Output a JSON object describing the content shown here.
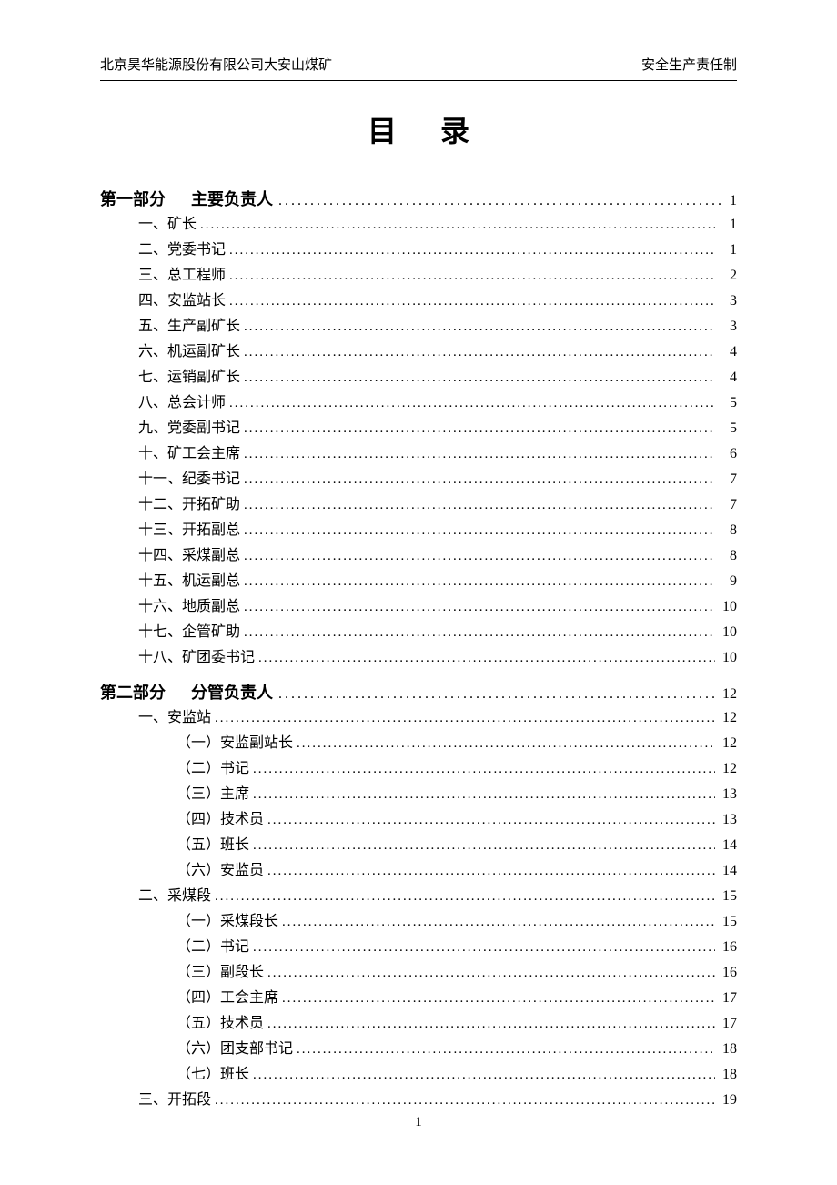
{
  "header": {
    "left": "北京昊华能源股份有限公司大安山煤矿",
    "right": "安全生产责任制"
  },
  "title": "目录",
  "footer_page": "1",
  "sections": [
    {
      "label": "第一部分",
      "title": "主要负责人",
      "page": "1",
      "items": [
        {
          "level": 1,
          "text": "一、矿长",
          "page": "1"
        },
        {
          "level": 1,
          "text": "二、党委书记",
          "page": "1"
        },
        {
          "level": 1,
          "text": "三、总工程师",
          "page": "2"
        },
        {
          "level": 1,
          "text": "四、安监站长",
          "page": "3"
        },
        {
          "level": 1,
          "text": "五、生产副矿长",
          "page": "3"
        },
        {
          "level": 1,
          "text": "六、机运副矿长",
          "page": "4"
        },
        {
          "level": 1,
          "text": "七、运销副矿长",
          "page": "4"
        },
        {
          "level": 1,
          "text": "八、总会计师",
          "page": "5"
        },
        {
          "level": 1,
          "text": "九、党委副书记",
          "page": "5"
        },
        {
          "level": 1,
          "text": "十、矿工会主席",
          "page": "6"
        },
        {
          "level": 1,
          "text": "十一、纪委书记",
          "page": "7"
        },
        {
          "level": 1,
          "text": "十二、开拓矿助",
          "page": "7"
        },
        {
          "level": 1,
          "text": "十三、开拓副总",
          "page": "8"
        },
        {
          "level": 1,
          "text": "十四、采煤副总",
          "page": "8"
        },
        {
          "level": 1,
          "text": "十五、机运副总",
          "page": "9"
        },
        {
          "level": 1,
          "text": "十六、地质副总",
          "page": "10"
        },
        {
          "level": 1,
          "text": "十七、企管矿助",
          "page": "10"
        },
        {
          "level": 1,
          "text": "十八、矿团委书记",
          "page": "10"
        }
      ]
    },
    {
      "label": "第二部分",
      "title": "分管负责人",
      "page": "12",
      "items": [
        {
          "level": 1,
          "text": "一、安监站",
          "page": "12"
        },
        {
          "level": 2,
          "text": "（一）安监副站长",
          "page": "12"
        },
        {
          "level": 2,
          "text": "（二）书记",
          "page": "12"
        },
        {
          "level": 2,
          "text": "（三）主席",
          "page": "13"
        },
        {
          "level": 2,
          "text": "（四）技术员",
          "page": "13"
        },
        {
          "level": 2,
          "text": "（五）班长",
          "page": "14"
        },
        {
          "level": 2,
          "text": "（六）安监员",
          "page": "14"
        },
        {
          "level": 1,
          "text": "二、采煤段",
          "page": "15"
        },
        {
          "level": 2,
          "text": "（一）采煤段长",
          "page": "15"
        },
        {
          "level": 2,
          "text": "（二）书记",
          "page": "16"
        },
        {
          "level": 2,
          "text": "（三）副段长",
          "page": "16"
        },
        {
          "level": 2,
          "text": "（四）工会主席",
          "page": "17"
        },
        {
          "level": 2,
          "text": "（五）技术员",
          "page": "17"
        },
        {
          "level": 2,
          "text": "（六）团支部书记",
          "page": "18"
        },
        {
          "level": 2,
          "text": "（七）班长",
          "page": "18"
        },
        {
          "level": 1,
          "text": "三、开拓段",
          "page": "19"
        }
      ]
    }
  ]
}
